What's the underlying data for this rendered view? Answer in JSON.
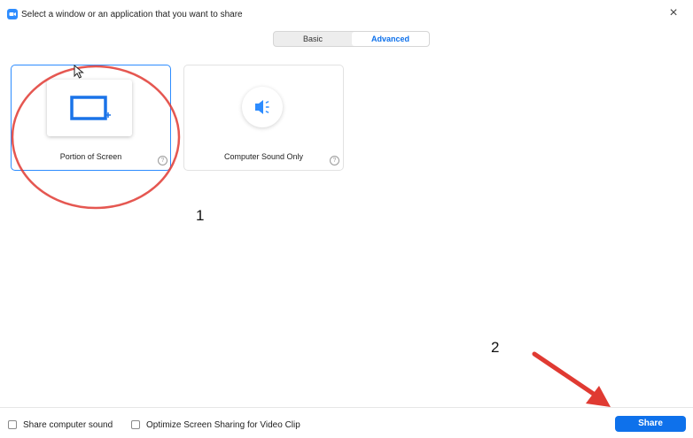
{
  "window": {
    "title": "Select a window or an application that you want to share",
    "close_icon": "close-icon",
    "app_icon": "zoom-logo-icon"
  },
  "tabs": [
    {
      "label": "Basic",
      "selected": false
    },
    {
      "label": "Advanced",
      "selected": true
    }
  ],
  "options": [
    {
      "label": "Portion of Screen",
      "icon": "portion-screen-icon",
      "selected": true
    },
    {
      "label": "Computer Sound Only",
      "icon": "speaker-icon",
      "selected": false
    }
  ],
  "help_glyph": "?",
  "annotations": {
    "step1": "1",
    "step2": "2"
  },
  "footer": {
    "share_sound_label": "Share computer sound",
    "optimize_label": "Optimize Screen Sharing for Video Clip",
    "share_button": "Share"
  },
  "colors": {
    "accent": "#0e71eb",
    "annotation_red": "#e03a32",
    "selected_border": "#2d8cff"
  }
}
